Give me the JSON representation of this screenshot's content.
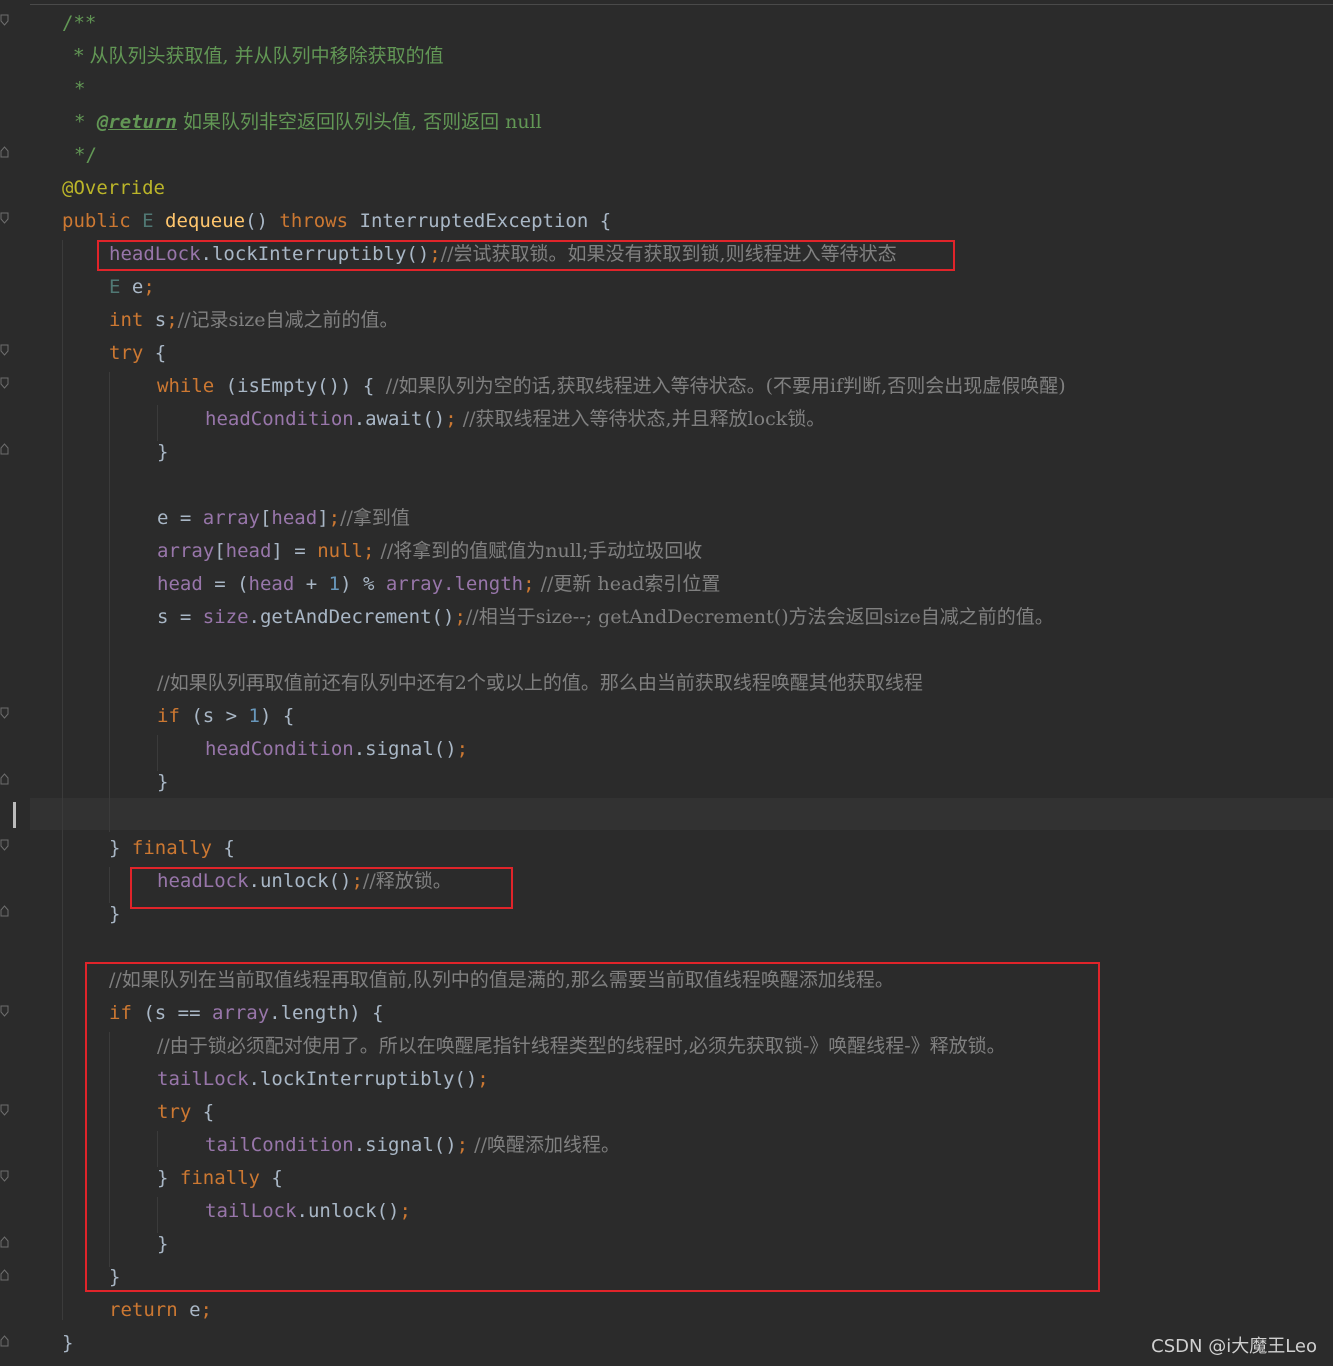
{
  "editor": {
    "theme": "darcula",
    "colors": {
      "background": "#2b2b2b",
      "keyword": "#cc7832",
      "comment": "#808080",
      "javadoc": "#629755",
      "field": "#9876aa",
      "method": "#ffc66d",
      "number": "#6897bb",
      "annotation": "#bbb529",
      "highlight_box": "#e0242a"
    }
  },
  "code": {
    "l1": "/**",
    "l2": "* 从队列头获取值, 并从队列中移除获取的值",
    "l3": "*",
    "l4_star": "* ",
    "l4_tag": "@return",
    "l4_text": " 如果队列非空返回队列头值, 否则返回 null",
    "l5": "*/",
    "l6": "@Override",
    "l7_public": "public",
    "l7_E": "E",
    "l7_name": "dequeue",
    "l7_paren": "()",
    "l7_throws": "throws",
    "l7_rest": "InterruptedException {",
    "l8_field": "headLock",
    "l8_call": ".lockInterruptibly()",
    "l8_semi": ";",
    "l8_comment": "//尝试获取锁。如果没有获取到锁,则线程进入等待状态",
    "l9_E": "E",
    "l9_var": " e",
    "l9_semi": ";",
    "l10_int": "int",
    "l10_var": " s",
    "l10_semi": ";",
    "l10_comment": "//记录size自减之前的值。",
    "l11_try": "try",
    "l11_brace": " {",
    "l12_while": "while",
    "l12_cond": " (isEmpty()) { ",
    "l12_comment": "//如果队列为空的话,获取线程进入等待状态。(不要用if判断,否则会出现虚假唤醒)",
    "l13_field": "headCondition",
    "l13_call": ".await()",
    "l13_semi": ";",
    "l13_comment": " //获取线程进入等待状态,并且释放lock锁。",
    "l14": "}",
    "l16_a": "e = ",
    "l16_field": "array",
    "l16_b": "[",
    "l16_field2": "head",
    "l16_c": "]",
    "l16_semi": ";",
    "l16_comment": "//拿到值",
    "l17_field": "array",
    "l17_a": "[",
    "l17_field2": "head",
    "l17_b": "] = ",
    "l17_null": "null",
    "l17_semi": ";",
    "l17_comment": " //将拿到的值赋值为null;手动垃圾回收",
    "l18_field": "head",
    "l18_a": " = (",
    "l18_field2": "head",
    "l18_b": " + ",
    "l18_num": "1",
    "l18_c": ") % ",
    "l18_field3": "array",
    "l18_d": ".length",
    "l18_semi": ";",
    "l18_comment": " //更新 head索引位置",
    "l19_a": "s = ",
    "l19_field": "size",
    "l19_call": ".getAndDecrement()",
    "l19_semi": ";",
    "l19_comment": "//相当于size--; getAndDecrement()方法会返回size自减之前的值。",
    "l21_comment": "//如果队列再取值前还有队列中还有2个或以上的值。那么由当前获取线程唤醒其他获取线程",
    "l22_if": "if",
    "l22_a": " (s > ",
    "l22_num": "1",
    "l22_b": ") {",
    "l23_field": "headCondition",
    "l23_call": ".signal()",
    "l23_semi": ";",
    "l24": "}",
    "l26_a": "} ",
    "l26_finally": "finally",
    "l26_b": " {",
    "l27_field": "headLock",
    "l27_call": ".unlock()",
    "l27_semi": ";",
    "l27_comment": "//释放锁。",
    "l28": "}",
    "l30_comment": "//如果队列在当前取值线程再取值前,队列中的值是满的,那么需要当前取值线程唤醒添加线程。",
    "l31_if": "if",
    "l31_a": " (s == ",
    "l31_field": "array",
    "l31_b": ".length) {",
    "l32_comment": "//由于锁必须配对使用了。所以在唤醒尾指针线程类型的线程时,必须先获取锁-》唤醒线程-》释放锁。",
    "l33_field": "tailLock",
    "l33_call": ".lockInterruptibly()",
    "l33_semi": ";",
    "l34_try": "try",
    "l34_brace": " {",
    "l35_field": "tailCondition",
    "l35_call": ".signal()",
    "l35_semi": ";",
    "l35_comment": " //唤醒添加线程。",
    "l36_a": "} ",
    "l36_finally": "finally",
    "l36_b": " {",
    "l37_field": "tailLock",
    "l37_call": ".unlock()",
    "l37_semi": ";",
    "l38": "}",
    "l39": "}",
    "l40_return": "return",
    "l40_var": " e",
    "l40_semi": ";",
    "l41": "}"
  },
  "watermark": "CSDN @i大魔王Leo"
}
